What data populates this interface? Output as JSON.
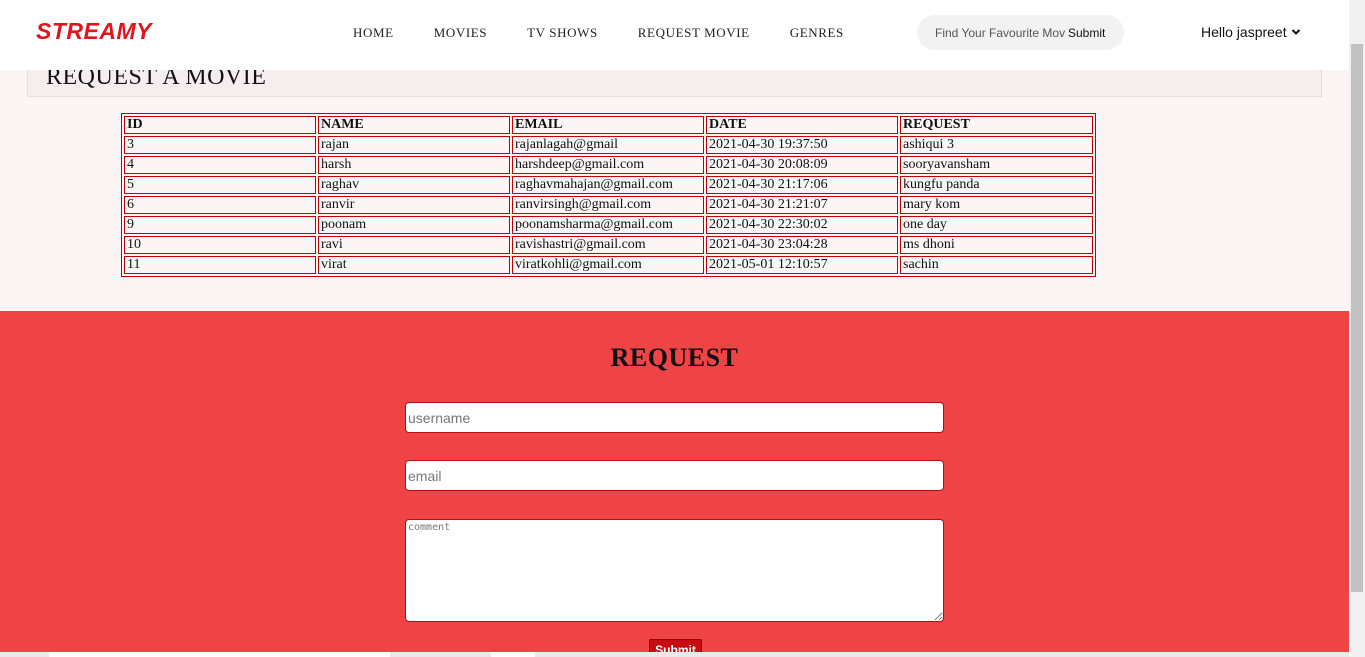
{
  "brand": "STREAMY",
  "nav": [
    "HOME",
    "MOVIES",
    "TV SHOWS",
    "REQUEST MOVIE",
    "GENRES"
  ],
  "search": {
    "placeholder": "Find Your Favourite Movie",
    "button": "Submit"
  },
  "user": {
    "greeting": "Hello jaspreet"
  },
  "page_title": "REQUEST A MOVIE",
  "table": {
    "headers": [
      "ID",
      "NAME",
      "EMAIL",
      "DATE",
      "REQUEST"
    ],
    "rows": [
      [
        "3",
        "rajan",
        "rajanlagah@gmail",
        "2021-04-30 19:37:50",
        "ashiqui 3"
      ],
      [
        "4",
        "harsh",
        "harshdeep@gmail.com",
        "2021-04-30 20:08:09",
        "sooryavansham"
      ],
      [
        "5",
        "raghav",
        "raghavmahajan@gmail.com",
        "2021-04-30 21:17:06",
        "kungfu panda"
      ],
      [
        "6",
        "ranvir",
        "ranvirsingh@gmail.com",
        "2021-04-30 21:21:07",
        "mary kom"
      ],
      [
        "9",
        "poonam",
        "poonamsharma@gmail.com",
        "2021-04-30 22:30:02",
        "one day"
      ],
      [
        "10",
        "ravi",
        "ravishastri@gmail.com",
        "2021-04-30 23:04:28",
        "ms dhoni"
      ],
      [
        "11",
        "virat",
        "viratkohli@gmail.com",
        "2021-05-01 12:10:57",
        "sachin"
      ]
    ]
  },
  "request_form": {
    "title": "REQUEST",
    "username_placeholder": "username",
    "email_placeholder": "email",
    "comment_placeholder": "comment",
    "submit": "Submit"
  },
  "colors": {
    "brand": "#e3141e",
    "section_bg": "#f04346",
    "table_border": "#c00000",
    "submit_bg": "#c60c10"
  },
  "icons": {
    "user_dropdown": "chevron-down-icon"
  }
}
